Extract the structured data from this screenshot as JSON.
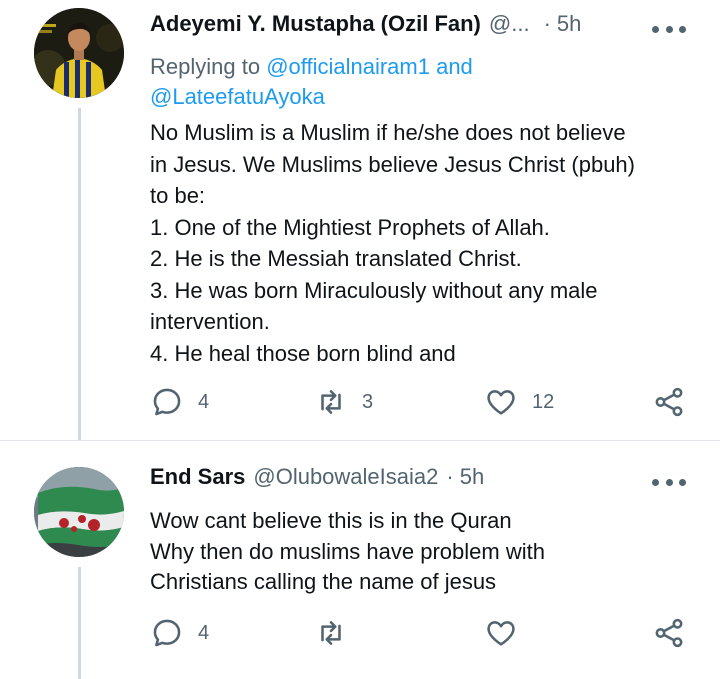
{
  "tweets": [
    {
      "display_name": "Adeyemi Y. Mustapha (Ozil Fan)",
      "handle": "@...",
      "time": "5h",
      "replying_prefix": "Replying to ",
      "mention_1": "@officialnairam1",
      "replying_join": " and",
      "mention_2": "@LateefatuAyoka",
      "lines": [
        "No Muslim is a Muslim if he/she does not believe",
        "in Jesus. We Muslims believe Jesus Christ (pbuh)",
        "to be:",
        "1. One of the Mightiest Prophets of Allah.",
        "2. He is the Messiah translated Christ.",
        "3. He was born Miraculously without any male",
        "intervention.",
        "4. He heal those born blind and"
      ],
      "reply_count": "4",
      "retweet_count": "3",
      "like_count": "12"
    },
    {
      "display_name": "End Sars",
      "handle": "@OlubowaleIsaia2",
      "time": "5h",
      "lines": [
        "Wow cant believe this is in the Quran",
        "Why then do muslims have problem with",
        "Christians calling the name of jesus"
      ],
      "reply_count": "4",
      "retweet_count": "",
      "like_count": ""
    }
  ],
  "icons": {
    "reply": "speech-bubble-icon",
    "retweet": "retweet-arrows-icon",
    "like": "heart-icon",
    "share": "share-nodes-icon",
    "more": "three-dots-icon"
  },
  "colors": {
    "text": "#0f1419",
    "secondary": "#536471",
    "link": "#1d9bf0",
    "thread_line": "#cfd9de"
  }
}
